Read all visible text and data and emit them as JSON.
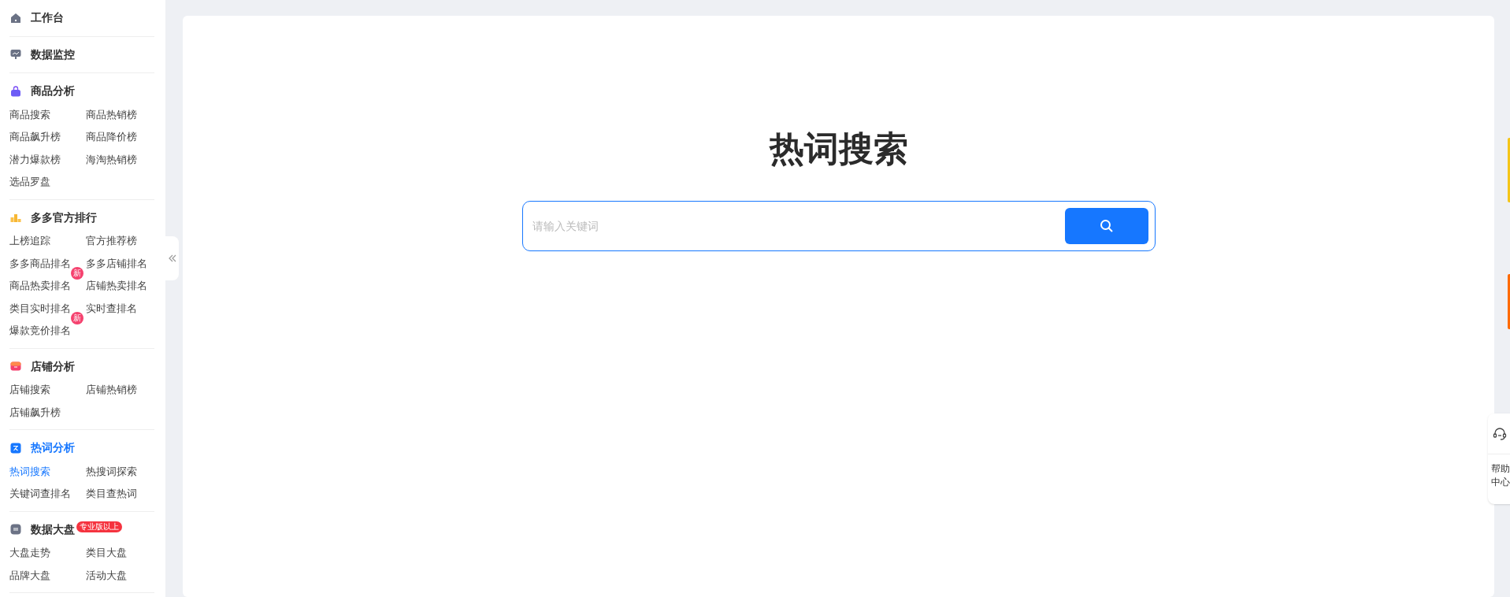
{
  "sidebar": {
    "sections": [
      {
        "title": "工作台",
        "selected": false
      },
      {
        "title": "数据监控",
        "selected": false
      },
      {
        "title": "商品分析",
        "selected": false,
        "items": [
          {
            "label": "商品搜索",
            "selected": false
          },
          {
            "label": "商品热销榜",
            "selected": false
          },
          {
            "label": "商品飙升榜",
            "selected": false
          },
          {
            "label": "商品降价榜",
            "selected": false
          },
          {
            "label": "潜力爆款榜",
            "selected": false
          },
          {
            "label": "海淘热销榜",
            "selected": false
          },
          {
            "label": "选品罗盘",
            "selected": false
          }
        ]
      },
      {
        "title": "多多官方排行",
        "selected": false,
        "items": [
          {
            "label": "上榜追踪",
            "selected": false
          },
          {
            "label": "官方推荐榜",
            "selected": false
          },
          {
            "label": "多多商品排名",
            "selected": false
          },
          {
            "label": "多多店铺排名",
            "selected": false
          },
          {
            "label": "商品热卖排名",
            "selected": false,
            "badge": "新"
          },
          {
            "label": "店铺热卖排名",
            "selected": false
          },
          {
            "label": "类目实时排名",
            "selected": false
          },
          {
            "label": "实时查排名",
            "selected": false
          },
          {
            "label": "爆款竞价排名",
            "selected": false,
            "badge": "新"
          }
        ]
      },
      {
        "title": "店铺分析",
        "selected": false,
        "items": [
          {
            "label": "店铺搜索",
            "selected": false
          },
          {
            "label": "店铺热销榜",
            "selected": false
          },
          {
            "label": "店铺飙升榜",
            "selected": false
          }
        ]
      },
      {
        "title": "热词分析",
        "selected": true,
        "items": [
          {
            "label": "热词搜索",
            "selected": true
          },
          {
            "label": "热搜词探索",
            "selected": false
          },
          {
            "label": "关键词查排名",
            "selected": false
          },
          {
            "label": "类目查热词",
            "selected": false
          }
        ]
      },
      {
        "title": "数据大盘",
        "selected": false,
        "badge": "专业版以上",
        "items": [
          {
            "label": "大盘走势",
            "selected": false
          },
          {
            "label": "类目大盘",
            "selected": false
          },
          {
            "label": "品牌大盘",
            "selected": false
          },
          {
            "label": "活动大盘",
            "selected": false
          }
        ]
      }
    ]
  },
  "main": {
    "title": "热词搜索",
    "search": {
      "placeholder": "请输入关键词"
    }
  },
  "help": {
    "label": "帮助中心"
  }
}
